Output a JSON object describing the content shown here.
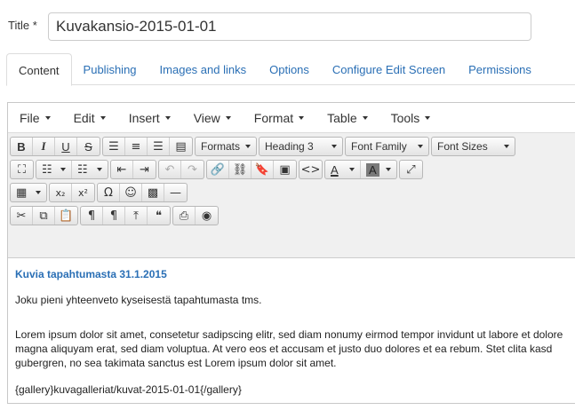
{
  "title_field": {
    "label": "Title *",
    "value": "Kuvakansio-2015-01-01"
  },
  "tabs": [
    {
      "label": "Content",
      "active": true
    },
    {
      "label": "Publishing"
    },
    {
      "label": "Images and links"
    },
    {
      "label": "Options"
    },
    {
      "label": "Configure Edit Screen"
    },
    {
      "label": "Permissions"
    }
  ],
  "menubar": [
    "File",
    "Edit",
    "Insert",
    "View",
    "Format",
    "Table",
    "Tools"
  ],
  "toolbar": {
    "bold": "B",
    "italic": "I",
    "underline": "U",
    "strikethrough": "S",
    "formats": "Formats",
    "heading": "Heading 3",
    "font_family": "Font Family",
    "font_sizes": "Font Sizes",
    "forecolor": "A",
    "backcolor": "A",
    "subscript": "x₂",
    "superscript": "x²",
    "omega": "Ω"
  },
  "content": {
    "heading": "Kuvia tapahtumasta  31.1.2015",
    "p1": "Joku pieni yhteenveto kyseisestä tapahtumasta tms.",
    "p2": "Lorem ipsum dolor sit amet, consetetur sadipscing elitr, sed diam nonumy eirmod tempor invidunt ut labore et dolore magna aliquyam erat, sed diam voluptua. At vero eos et accusam et justo duo dolores et ea rebum. Stet clita kasd gubergren, no sea takimata sanctus est Lorem ipsum dolor sit amet.",
    "p3": "{gallery}kuvagalleriat/kuvat-2015-01-01{/gallery}"
  }
}
